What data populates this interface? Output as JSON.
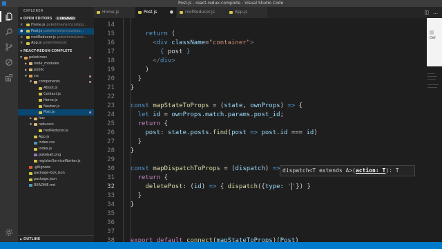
{
  "window": {
    "title": "Post.js - react-redux-complete - Visual Studio Code",
    "menu": "File  Edit  Selection  View  Go  Debug  Tasks  Help"
  },
  "activity_bar": [
    "files-icon",
    "search-icon",
    "source-control-icon",
    "debug-icon",
    "extensions-icon"
  ],
  "sidebar": {
    "title": "EXPLORER",
    "open_editors": {
      "label": "OPEN EDITORS",
      "badge": "1 UNSAVED",
      "items": [
        {
          "name": "Home.js",
          "path": "poketimes\\src\\compo..."
        },
        {
          "name": "Post.js",
          "path": "poketimes\\src\\compo..."
        },
        {
          "name": "rootReducer.js",
          "path": "poketimes\\src\\r..."
        },
        {
          "name": "App.js",
          "path": "poketimes\\src"
        }
      ]
    },
    "project": {
      "label": "REACT-REDUX-COMPLETE",
      "tree": [
        {
          "name": "poketimes",
          "depth": 0,
          "type": "folder-src",
          "open": true
        },
        {
          "name": "node_modules",
          "depth": 1,
          "type": "folder",
          "open": false
        },
        {
          "name": "public",
          "depth": 1,
          "type": "folder",
          "open": false
        },
        {
          "name": "src",
          "depth": 1,
          "type": "folder-src",
          "open": true
        },
        {
          "name": "components",
          "depth": 2,
          "type": "folder",
          "open": true
        },
        {
          "name": "About.js",
          "depth": 3,
          "type": "js"
        },
        {
          "name": "Contact.js",
          "depth": 3,
          "type": "js"
        },
        {
          "name": "Home.js",
          "depth": 3,
          "type": "js"
        },
        {
          "name": "Navbar.js",
          "depth": 3,
          "type": "js"
        },
        {
          "name": "Post.js",
          "depth": 3,
          "type": "js",
          "selected": true
        },
        {
          "name": "hoc",
          "depth": 2,
          "type": "folder",
          "open": false
        },
        {
          "name": "reducers",
          "depth": 2,
          "type": "folder",
          "open": true
        },
        {
          "name": "rootReducer.js",
          "depth": 3,
          "type": "js"
        },
        {
          "name": "App.js",
          "depth": 2,
          "type": "js"
        },
        {
          "name": "index.css",
          "depth": 2,
          "type": "css"
        },
        {
          "name": "index.js",
          "depth": 2,
          "type": "js"
        },
        {
          "name": "pokeball.png",
          "depth": 2,
          "type": "img"
        },
        {
          "name": "registerServiceWorker.js",
          "depth": 2,
          "type": "js"
        },
        {
          "name": ".gitignore",
          "depth": 1,
          "type": "git"
        },
        {
          "name": "package-lock.json",
          "depth": 1,
          "type": "json"
        },
        {
          "name": "package.json",
          "depth": 1,
          "type": "json"
        },
        {
          "name": "README.md",
          "depth": 1,
          "type": "md"
        }
      ]
    },
    "outline": "OUTLINE"
  },
  "tabs": [
    {
      "label": "Home.js",
      "active": false
    },
    {
      "label": "Post.js",
      "active": true
    },
    {
      "label": "rootReducer.js",
      "active": false
    },
    {
      "label": "App.js",
      "active": false
    }
  ],
  "editor": {
    "lines": [
      {
        "n": "14",
        "tokens": []
      },
      {
        "n": "15",
        "tokens": [
          [
            "k",
            "return "
          ],
          [
            "p",
            "("
          ]
        ],
        "indent": 6
      },
      {
        "n": "16",
        "tokens": [
          [
            "tg",
            "<"
          ],
          [
            "k",
            "div "
          ],
          [
            "v",
            "className"
          ],
          [
            "p",
            "="
          ],
          [
            "s",
            "\"container\""
          ],
          [
            "tg",
            ">"
          ]
        ],
        "indent": 8
      },
      {
        "n": "17",
        "tokens": [
          [
            "k",
            "{ "
          ],
          [
            "p",
            "post "
          ],
          [
            "k",
            "}"
          ]
        ],
        "indent": 10
      },
      {
        "n": "18",
        "tokens": [
          [
            "tg",
            "</"
          ],
          [
            "k",
            "div"
          ],
          [
            "tg",
            ">"
          ]
        ],
        "indent": 8
      },
      {
        "n": "19",
        "tokens": [
          [
            "p",
            ")"
          ]
        ],
        "indent": 6
      },
      {
        "n": "20",
        "tokens": [
          [
            "p",
            "}"
          ]
        ],
        "indent": 4
      },
      {
        "n": "21",
        "tokens": [
          [
            "p",
            "}"
          ]
        ],
        "indent": 2
      },
      {
        "n": "22",
        "tokens": []
      },
      {
        "n": "23",
        "tokens": [
          [
            "k",
            "const "
          ],
          [
            "f",
            "mapStateToProps"
          ],
          [
            "p",
            " = ("
          ],
          [
            "v",
            "state"
          ],
          [
            "p",
            ", "
          ],
          [
            "v",
            "ownProps"
          ],
          [
            "p",
            ") "
          ],
          [
            "k",
            "=>"
          ],
          [
            "p",
            " {"
          ]
        ],
        "indent": 2
      },
      {
        "n": "24",
        "tokens": [
          [
            "k",
            "let "
          ],
          [
            "v",
            "id"
          ],
          [
            "p",
            " = "
          ],
          [
            "v",
            "ownProps"
          ],
          [
            "p",
            "."
          ],
          [
            "v",
            "match"
          ],
          [
            "p",
            "."
          ],
          [
            "v",
            "params"
          ],
          [
            "p",
            "."
          ],
          [
            "v",
            "post_id"
          ],
          [
            "p",
            ";"
          ]
        ],
        "indent": 4
      },
      {
        "n": "25",
        "tokens": [
          [
            "kc",
            "return "
          ],
          [
            "p",
            "{"
          ]
        ],
        "indent": 4
      },
      {
        "n": "26",
        "tokens": [
          [
            "v",
            "post"
          ],
          [
            "p",
            ": "
          ],
          [
            "v",
            "state"
          ],
          [
            "p",
            "."
          ],
          [
            "v",
            "posts"
          ],
          [
            "p",
            "."
          ],
          [
            "f",
            "find"
          ],
          [
            "p",
            "("
          ],
          [
            "v",
            "post"
          ],
          [
            "p",
            " "
          ],
          [
            "k",
            "=>"
          ],
          [
            "p",
            " "
          ],
          [
            "v",
            "post"
          ],
          [
            "p",
            "."
          ],
          [
            "v",
            "id"
          ],
          [
            "p",
            " === "
          ],
          [
            "v",
            "id"
          ],
          [
            "p",
            ")"
          ]
        ],
        "indent": 6
      },
      {
        "n": "27",
        "tokens": [
          [
            "p",
            "}"
          ]
        ],
        "indent": 4
      },
      {
        "n": "28",
        "tokens": [
          [
            "p",
            "}"
          ]
        ],
        "indent": 2
      },
      {
        "n": "29",
        "tokens": []
      },
      {
        "n": "30",
        "tokens": [
          [
            "k",
            "const "
          ],
          [
            "f",
            "mapDispatchToProps"
          ],
          [
            "p",
            " = ("
          ],
          [
            "v",
            "dispatch"
          ],
          [
            "p",
            ") "
          ],
          [
            "k",
            "=>"
          ],
          [
            "p",
            " {"
          ]
        ],
        "indent": 2
      },
      {
        "n": "31",
        "tokens": [
          [
            "kc",
            "return "
          ],
          [
            "p",
            "{"
          ]
        ],
        "indent": 4
      },
      {
        "n": "32",
        "tokens": [
          [
            "f",
            "deletePost"
          ],
          [
            "p",
            ": ("
          ],
          [
            "v",
            "id"
          ],
          [
            "p",
            ") "
          ],
          [
            "k",
            "=>"
          ],
          [
            "p",
            " { "
          ],
          [
            "f",
            "dispatch"
          ],
          [
            "p",
            "({"
          ],
          [
            "v",
            "type"
          ],
          [
            "p",
            ": "
          ],
          [
            "s",
            "'"
          ],
          [
            "cursor",
            ""
          ],
          [
            "s",
            "'"
          ],
          [
            "p",
            "}) }"
          ]
        ],
        "indent": 6,
        "current": true
      },
      {
        "n": "33",
        "tokens": [
          [
            "p",
            "}"
          ]
        ],
        "indent": 4
      },
      {
        "n": "34",
        "tokens": [
          [
            "p",
            "}"
          ]
        ],
        "indent": 2
      },
      {
        "n": "35",
        "tokens": []
      },
      {
        "n": "36",
        "tokens": []
      },
      {
        "n": "37",
        "tokens": []
      },
      {
        "n": "38",
        "tokens": [
          [
            "kc",
            "export "
          ],
          [
            "kc",
            "default "
          ],
          [
            "f",
            "connect"
          ],
          [
            "p",
            "("
          ],
          [
            "v",
            "mapStateToProps"
          ],
          [
            "p",
            ")("
          ],
          [
            "v",
            "Post"
          ],
          [
            "p",
            ")"
          ]
        ],
        "indent": 2
      },
      {
        "n": "39",
        "tokens": []
      }
    ],
    "signature_hint": {
      "prefix": "dispatch<T extends A>(",
      "param": "action: T",
      "suffix": "): T"
    }
  },
  "overlay_text": "Def"
}
